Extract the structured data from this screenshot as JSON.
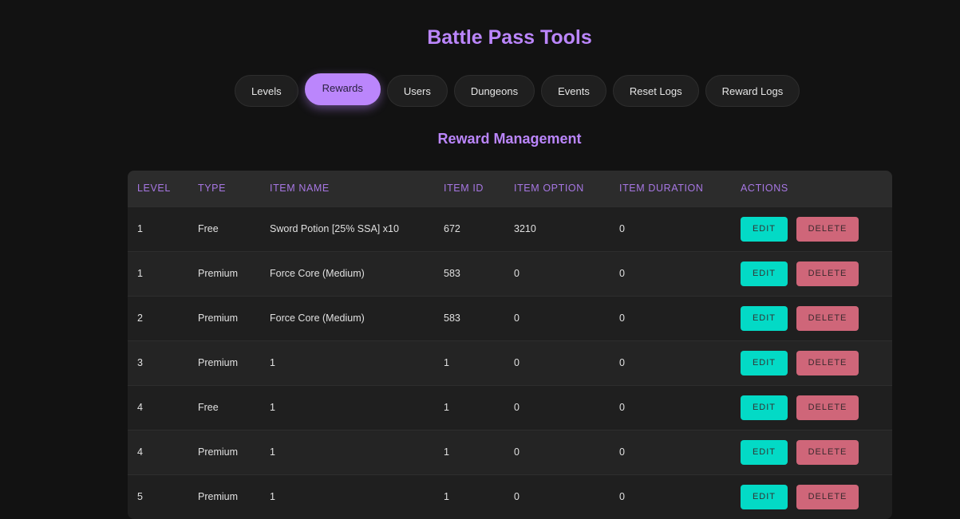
{
  "header": {
    "title": "Battle Pass Tools"
  },
  "nav": {
    "tabs": [
      {
        "label": "Levels",
        "active": false
      },
      {
        "label": "Rewards",
        "active": true
      },
      {
        "label": "Users",
        "active": false
      },
      {
        "label": "Dungeons",
        "active": false
      },
      {
        "label": "Events",
        "active": false
      },
      {
        "label": "Reset Logs",
        "active": false
      },
      {
        "label": "Reward Logs",
        "active": false
      }
    ]
  },
  "section": {
    "title": "Reward Management"
  },
  "table": {
    "columns": [
      "LEVEL",
      "TYPE",
      "ITEM NAME",
      "ITEM ID",
      "ITEM OPTION",
      "ITEM DURATION",
      "ACTIONS"
    ],
    "actions": {
      "edit_label": "EDIT",
      "delete_label": "DELETE"
    },
    "rows": [
      {
        "level": "1",
        "type": "Free",
        "item_name": "Sword Potion [25% SSA] x10",
        "item_id": "672",
        "item_option": "3210",
        "item_duration": "0"
      },
      {
        "level": "1",
        "type": "Premium",
        "item_name": "Force Core (Medium)",
        "item_id": "583",
        "item_option": "0",
        "item_duration": "0"
      },
      {
        "level": "2",
        "type": "Premium",
        "item_name": "Force Core (Medium)",
        "item_id": "583",
        "item_option": "0",
        "item_duration": "0"
      },
      {
        "level": "3",
        "type": "Premium",
        "item_name": "1",
        "item_id": "1",
        "item_option": "0",
        "item_duration": "0"
      },
      {
        "level": "4",
        "type": "Free",
        "item_name": "1",
        "item_id": "1",
        "item_option": "0",
        "item_duration": "0"
      },
      {
        "level": "4",
        "type": "Premium",
        "item_name": "1",
        "item_id": "1",
        "item_option": "0",
        "item_duration": "0"
      },
      {
        "level": "5",
        "type": "Premium",
        "item_name": "1",
        "item_id": "1",
        "item_option": "0",
        "item_duration": "0"
      }
    ]
  },
  "colors": {
    "accent": "#bb86fc",
    "edit": "#03dac6",
    "delete": "#cf6679",
    "background": "#121212"
  }
}
